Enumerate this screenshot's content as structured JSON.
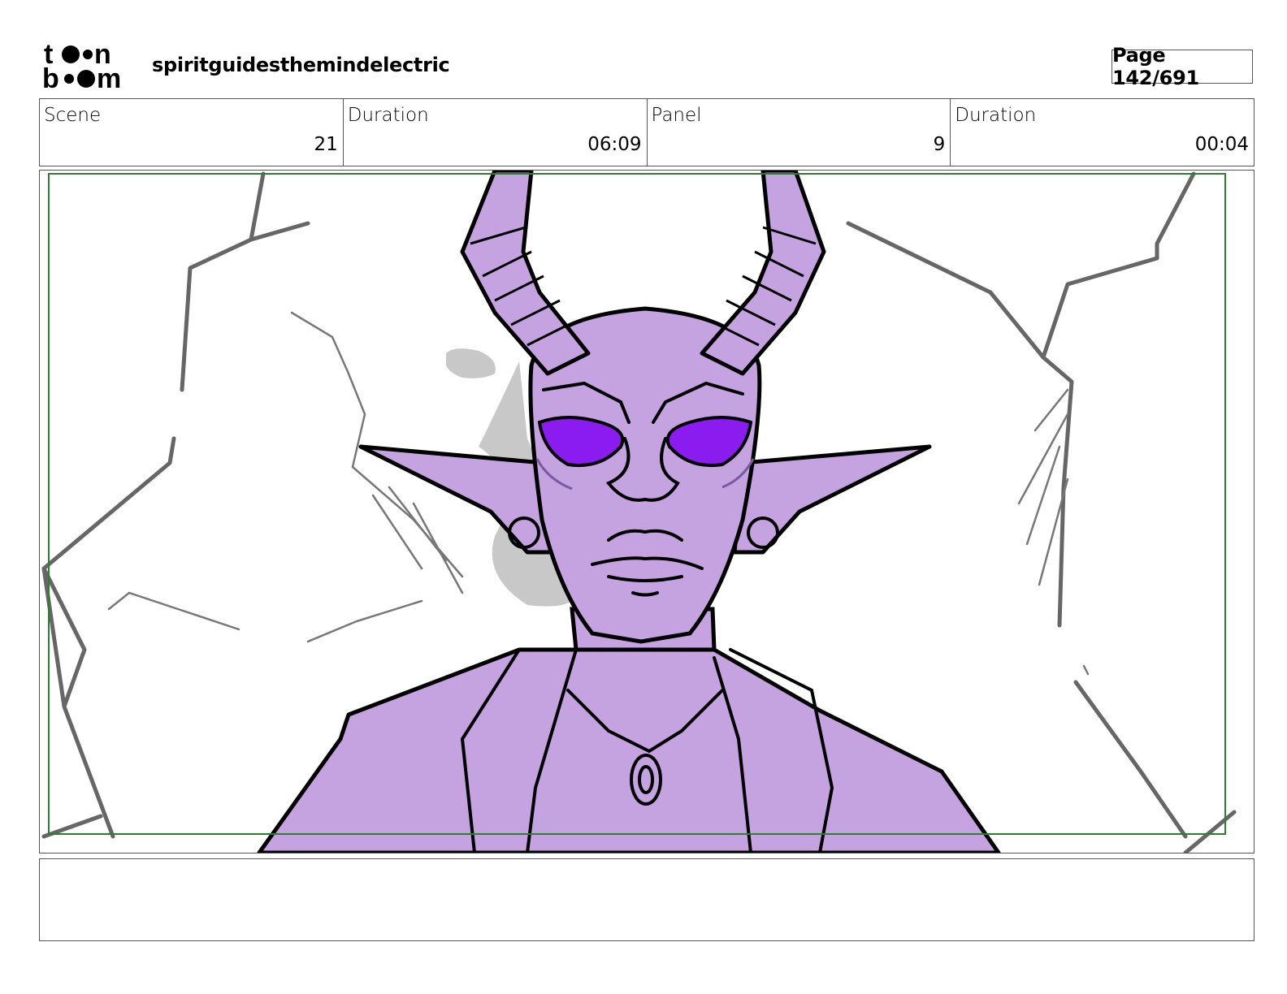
{
  "header": {
    "logo_text": "toon boom",
    "project_title": "spiritguidesthemindelectric",
    "page_indicator": "Page 142/691"
  },
  "info": {
    "scene_label": "Scene",
    "scene_value": "21",
    "scene_duration_label": "Duration",
    "scene_duration_value": "06:09",
    "panel_label": "Panel",
    "panel_value": "9",
    "panel_duration_label": "Duration",
    "panel_duration_value": "00:04"
  },
  "panel": {
    "safe_frame_color": "#2e7d32",
    "skin_color": "#c4a3e0",
    "eye_color": "#8a1cf0"
  },
  "notes": {
    "text": ""
  }
}
